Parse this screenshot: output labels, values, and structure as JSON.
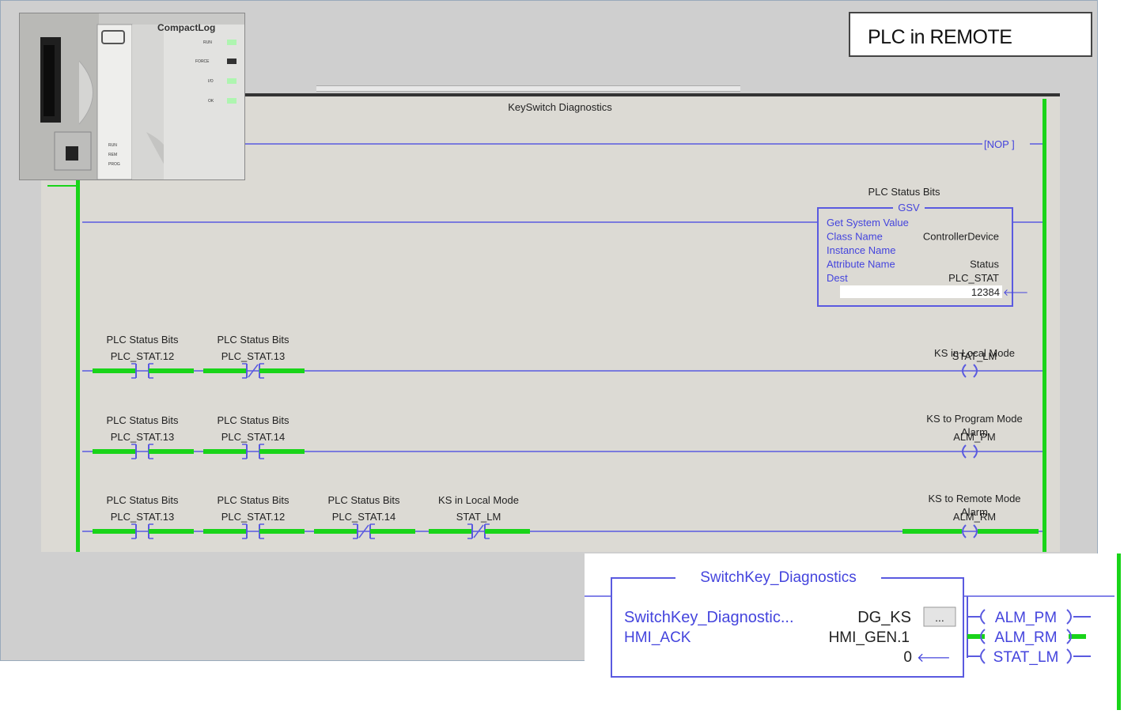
{
  "photo": {
    "brand": "CompactLog",
    "leds": [
      "RUN",
      "FORCE",
      "I/O",
      "OK"
    ],
    "switch_labels": [
      "RUN",
      "REM",
      "PROG"
    ]
  },
  "remote_label": "PLC in REMOTE",
  "rung_comment": "KeySwitch Diagnostics",
  "nop": "[NOP ]",
  "gsv": {
    "comment": "PLC Status Bits",
    "title": "GSV",
    "rows": [
      {
        "label": "Get System Value",
        "value": ""
      },
      {
        "label": "Class Name",
        "value": "ControllerDevice"
      },
      {
        "label": "Instance Name",
        "value": ""
      },
      {
        "label": "Attribute Name",
        "value": "Status"
      },
      {
        "label": "Dest",
        "value": "PLC_STAT"
      }
    ],
    "dest_value": "12384"
  },
  "rungs": [
    {
      "contacts": [
        {
          "desc": "PLC Status Bits",
          "tag": "PLC_STAT.12",
          "type": "XIC"
        },
        {
          "desc": "PLC Status Bits",
          "tag": "PLC_STAT.13",
          "type": "XIO"
        }
      ],
      "coil": {
        "desc": [
          "KS in Local Mode"
        ],
        "tag": "STAT_LM"
      }
    },
    {
      "contacts": [
        {
          "desc": "PLC Status Bits",
          "tag": "PLC_STAT.13",
          "type": "XIC"
        },
        {
          "desc": "PLC Status Bits",
          "tag": "PLC_STAT.14",
          "type": "XIC"
        }
      ],
      "coil": {
        "desc": [
          "KS to Program Mode",
          "Alarm"
        ],
        "tag": "ALM_PM"
      }
    },
    {
      "contacts": [
        {
          "desc": "PLC Status Bits",
          "tag": "PLC_STAT.13",
          "type": "XIC"
        },
        {
          "desc": "PLC Status Bits",
          "tag": "PLC_STAT.12",
          "type": "XIC"
        },
        {
          "desc": "PLC Status Bits",
          "tag": "PLC_STAT.14",
          "type": "XIO"
        },
        {
          "desc": "KS in Local Mode",
          "tag": "STAT_LM",
          "type": "XIO"
        }
      ],
      "coil": {
        "desc": [
          "KS to Remote Mode",
          "Alarm"
        ],
        "tag": "ALM_RM"
      }
    }
  ],
  "aoi": {
    "title": "SwitchKey_Diagnostics",
    "row1_label": "SwitchKey_Diagnostic...",
    "row1_value": "DG_KS",
    "browse": "...",
    "row2_label": "HMI_ACK",
    "row2_value": "HMI_GEN.1",
    "row3_value": "0",
    "outputs": [
      "ALM_PM",
      "ALM_RM",
      "STAT_LM"
    ]
  },
  "colors": {
    "energized": "#19d419",
    "wire": "#5a5ae0",
    "text_blue": "#4444dd"
  }
}
